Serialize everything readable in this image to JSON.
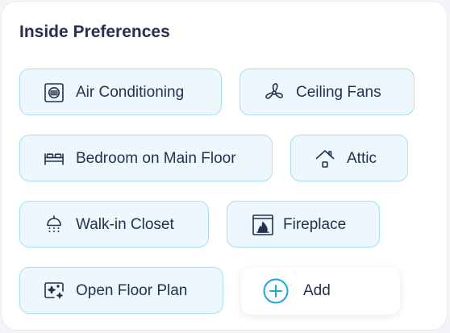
{
  "section": {
    "title": "Inside Preferences"
  },
  "chips": [
    {
      "label": "Air Conditioning",
      "icon": "air-conditioner-icon"
    },
    {
      "label": "Ceiling Fans",
      "icon": "ceiling-fan-icon"
    },
    {
      "label": "Bedroom on Main Floor",
      "icon": "bed-icon"
    },
    {
      "label": "Attic",
      "icon": "attic-house-icon"
    },
    {
      "label": "Walk-in Closet",
      "icon": "closet-icon"
    },
    {
      "label": "Fireplace",
      "icon": "fireplace-icon"
    },
    {
      "label": "Open Floor Plan",
      "icon": "open-floor-plan-icon"
    }
  ],
  "add": {
    "label": "Add",
    "icon": "plus-circle-icon"
  },
  "colors": {
    "chip_background": "#ecf8fd",
    "chip_border": "#aadcf0",
    "text": "#26304f",
    "accent": "#1ea5e0"
  }
}
